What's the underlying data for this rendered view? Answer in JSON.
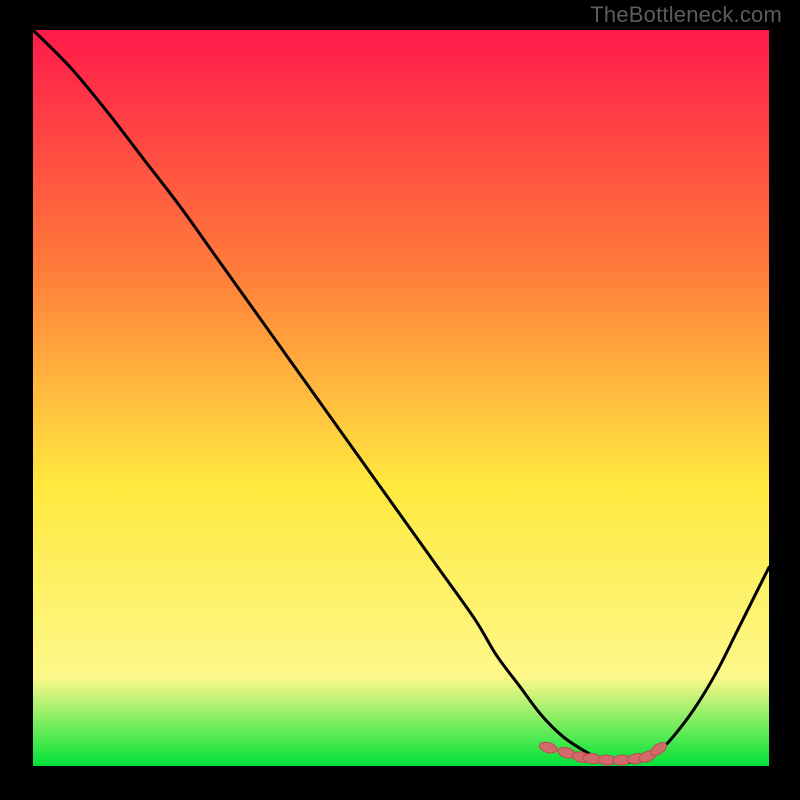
{
  "watermark": "TheBottleneck.com",
  "colors": {
    "gradient_top": "#ff1a4b",
    "gradient_mid1": "#ff7a3a",
    "gradient_mid2": "#ffe93f",
    "gradient_mid3": "#fdf88a",
    "gradient_bottom": "#00e238",
    "curve": "#000000",
    "marker_fill": "#d36a6a",
    "marker_stroke": "#b64f53",
    "frame": "#000000"
  },
  "chart_data": {
    "type": "line",
    "title": "",
    "xlabel": "",
    "ylabel": "",
    "xlim": [
      0,
      100
    ],
    "ylim": [
      0,
      100
    ],
    "grid": false,
    "series": [
      {
        "name": "bottleneck-curve",
        "x": [
          0,
          5,
          10,
          15,
          20,
          25,
          30,
          35,
          40,
          45,
          50,
          55,
          60,
          63,
          66,
          69,
          72,
          75,
          77,
          79,
          81,
          83,
          85,
          87,
          90,
          93,
          96,
          100
        ],
        "y": [
          100,
          95,
          89,
          82.5,
          76,
          69,
          62,
          55,
          48,
          41,
          34,
          27,
          20,
          15,
          11,
          7,
          4,
          2,
          1,
          0.5,
          0.5,
          1,
          2,
          4,
          8,
          13,
          19,
          27
        ]
      }
    ],
    "markers": {
      "name": "optimal-range",
      "x": [
        70,
        72.5,
        74.5,
        76,
        78,
        80,
        82,
        83.5,
        85
      ],
      "y": [
        2.5,
        1.8,
        1.2,
        1,
        0.8,
        0.8,
        1,
        1.3,
        2.3
      ]
    }
  }
}
